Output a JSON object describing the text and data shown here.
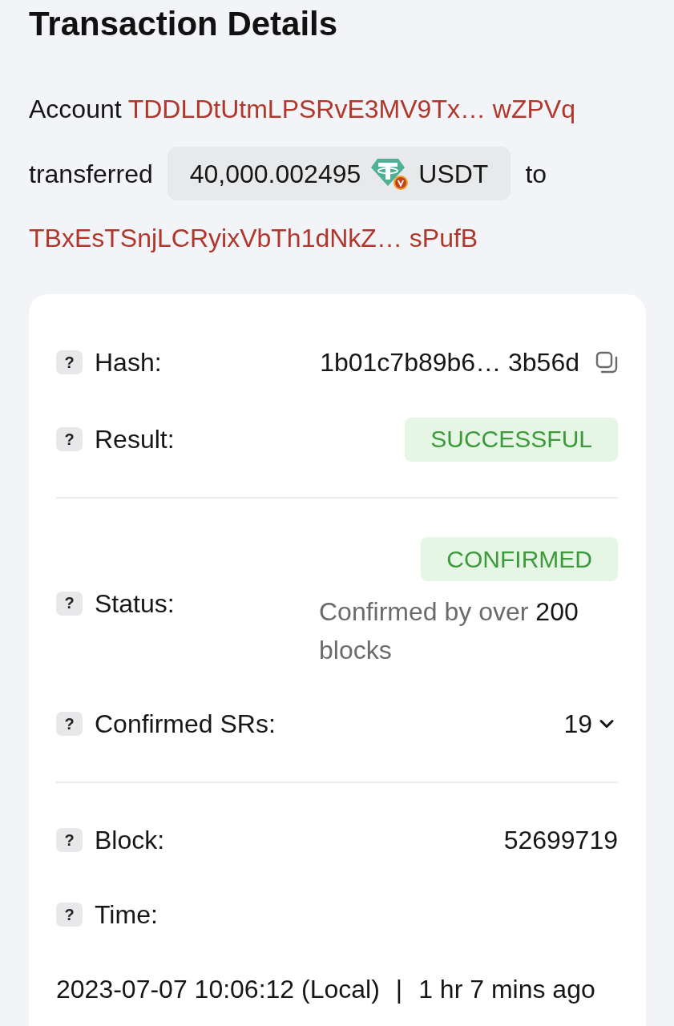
{
  "title": "Transaction Details",
  "summary": {
    "account_label": "Account",
    "from_address": "TDDLDtUtmLPSRvE3MV9Tx… wZPVq",
    "transferred_label": "transferred",
    "amount": "40,000.002495",
    "token": "USDT",
    "to_label": "to",
    "to_address": "TBxEsTSnjLCRyixVbTh1dNkZ… sPufB"
  },
  "sections": [
    {
      "rows": [
        {
          "kind": "copyable",
          "help": "?",
          "label": "Hash:",
          "value": "1b01c7b89b6… 3b56d"
        },
        {
          "kind": "status",
          "help": "?",
          "label": "Result:",
          "badge": "SUCCESSFUL"
        }
      ]
    },
    {
      "rows": [
        {
          "kind": "status_note",
          "help": "?",
          "label": "Status:",
          "badge": "CONFIRMED",
          "note": "Confirmed by over **200** blocks"
        },
        {
          "kind": "dropdown",
          "help": "?",
          "label": "Confirmed SRs:",
          "value": "19",
          "expanded": false
        }
      ]
    },
    {
      "rows": [
        {
          "kind": "text",
          "help": "?",
          "label": "Block:",
          "value": "52699719"
        },
        {
          "kind": "time",
          "help": "?",
          "label": "Time:",
          "timestamp": "2023-07-07 10:06:12 (Local)",
          "separator": "|",
          "relative": "1 hr 7 mins ago"
        }
      ]
    }
  ]
}
